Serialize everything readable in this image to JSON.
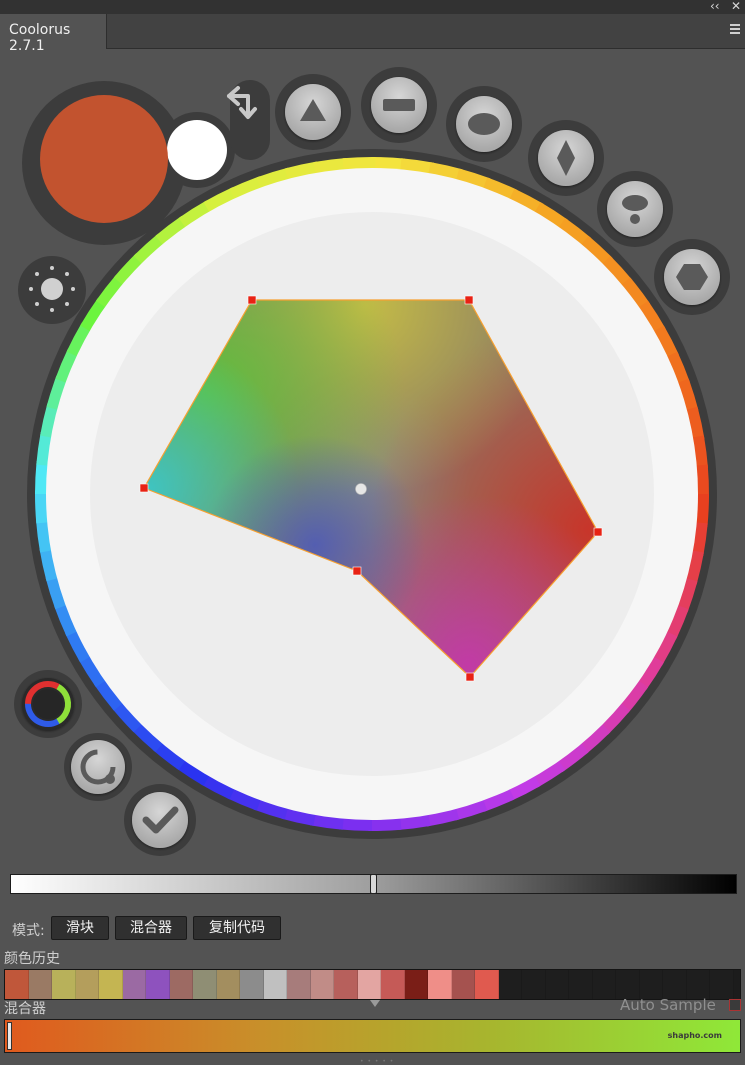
{
  "window": {
    "collapse_glyph": "‹‹",
    "close_glyph": "✕",
    "tab_title": "Coolorus 2.7.1",
    "menu_icon": "hamburger-icon"
  },
  "colors": {
    "foreground": "#C2532F",
    "background": "#FFFFFF",
    "ring_gradient": [
      "#F4E43E",
      "#F5A623",
      "#F27A1E",
      "#E8401F",
      "#E03C9A",
      "#C23BE6",
      "#7B2FF0",
      "#2A33F0",
      "#2F7BF2",
      "#4FE8F5",
      "#6CF53E",
      "#D6F03E"
    ]
  },
  "shape_buttons": [
    {
      "name": "triangle-shape-icon"
    },
    {
      "name": "rectangle-shape-icon"
    },
    {
      "name": "ellipse-shape-icon"
    },
    {
      "name": "diamond-shape-icon"
    },
    {
      "name": "drop-shape-icon"
    },
    {
      "name": "hexagon-shape-icon"
    }
  ],
  "left_tools": [
    "swap-colors-icon",
    "brightness-icon",
    "color-ring-icon",
    "rotate-icon",
    "checkmark-icon"
  ],
  "brightness_slider": {
    "value": 0.5
  },
  "modes": {
    "label": "模式:",
    "buttons": [
      "滑块",
      "混合器",
      "复制代码"
    ]
  },
  "history": {
    "label": "颜色历史",
    "swatches": [
      "#C0573A",
      "#9A7A64",
      "#B8B15A",
      "#B49E5C",
      "#C4B552",
      "#9B6AA3",
      "#8E52BE",
      "#9D6A63",
      "#8F8E74",
      "#A38E5F",
      "#8C8C8C",
      "#C0C0C0",
      "#A77C7B",
      "#C18C87",
      "#B7605C",
      "#E3A5A2",
      "#C55A57",
      "#7A1E17",
      "#EF8E88",
      "#A5524F",
      "#E05A4F",
      "#1E1E1E",
      "#1E1E1E",
      "#1E1E1E",
      "#1E1E1E",
      "#1E1E1E",
      "#1E1E1E",
      "#1E1E1E",
      "#1E1E1E",
      "#1E1E1E",
      "#1E1E1E"
    ]
  },
  "mixer": {
    "label": "混合器",
    "auto_sample": "Auto Sample",
    "start_color": "#E05A1E",
    "end_color": "#8FE838",
    "value": 0
  },
  "watermark": "shapho.com"
}
